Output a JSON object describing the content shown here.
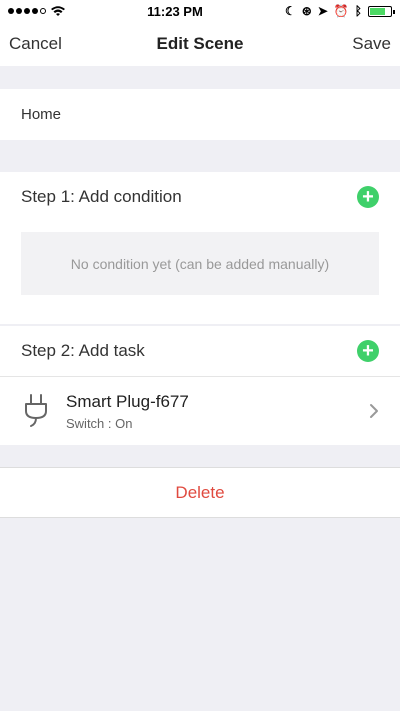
{
  "status_bar": {
    "time": "11:23 PM",
    "battery_level": 0.75,
    "battery_color": "#4cd964"
  },
  "nav": {
    "left_label": "Cancel",
    "title": "Edit Scene",
    "right_label": "Save"
  },
  "scene_name": "Home",
  "condition": {
    "header": "Step 1: Add condition",
    "empty_text": "No condition yet (can be added manually)",
    "add_icon": "plus-circle-icon"
  },
  "task": {
    "header": "Step 2: Add task",
    "add_icon": "plus-circle-icon",
    "items": [
      {
        "name": "Smart Plug-f677",
        "detail": "Switch : On",
        "icon": "plug-icon"
      }
    ]
  },
  "delete_label": "Delete",
  "colors": {
    "accent_green": "#3fd06a",
    "delete_red": "#e04a3f",
    "background": "#efeff4"
  }
}
